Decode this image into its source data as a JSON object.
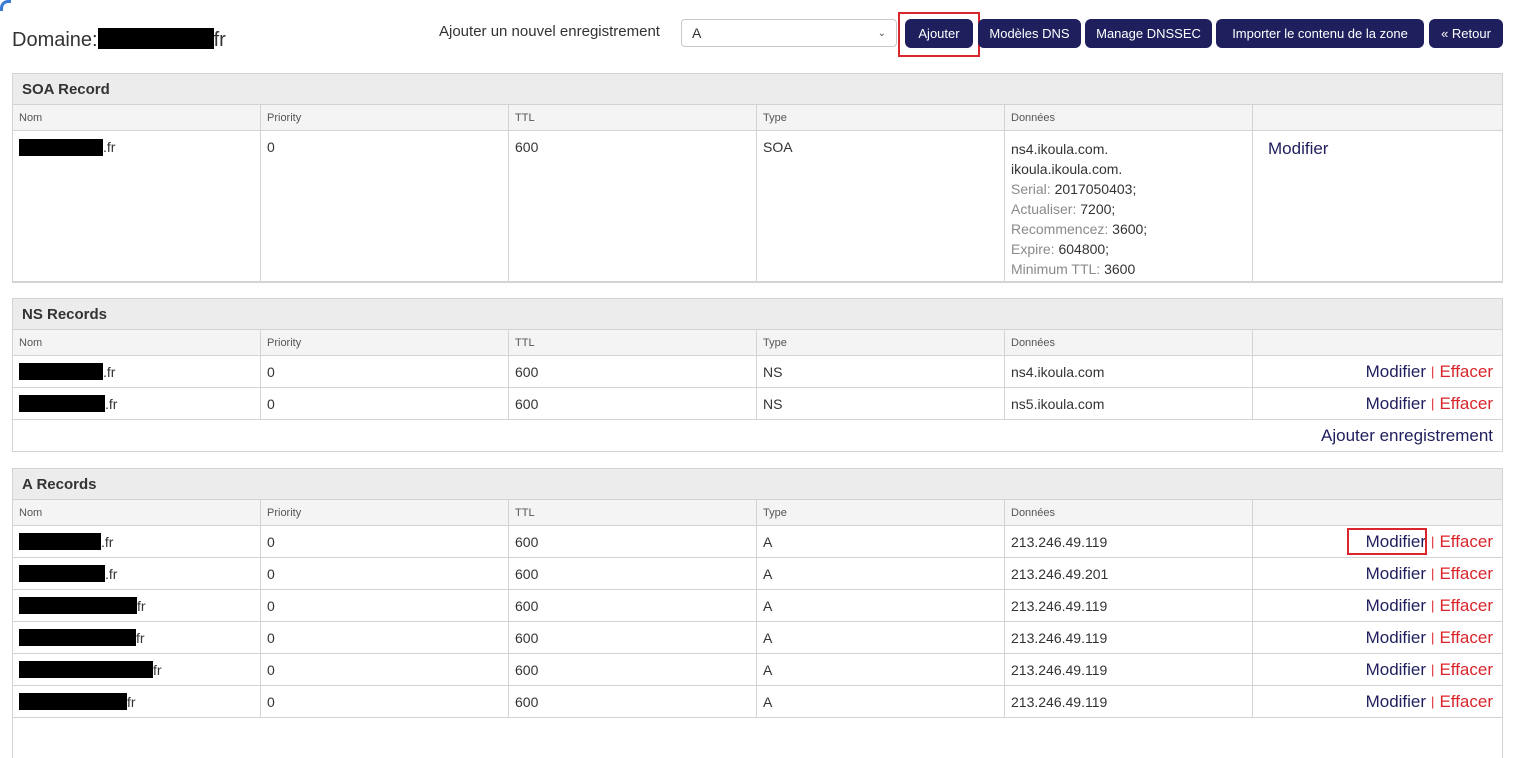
{
  "header": {
    "domain_label": "Domaine:",
    "domain_suffix": "fr",
    "add_label": "Ajouter un nouvel enregistrement",
    "record_type_value": "A",
    "buttons": {
      "add": "Ajouter",
      "dns_templates": "Modèles DNS",
      "dnssec": "Manage DNSSEC",
      "import_zone": "Importer le contenu de la zone",
      "back": "« Retour"
    }
  },
  "columns": {
    "name": "Nom",
    "priority": "Priority",
    "ttl": "TTL",
    "type": "Type",
    "data": "Données"
  },
  "actions": {
    "modify": "Modifier",
    "delete": "Effacer",
    "separator": "|",
    "add_record": "Ajouter enregistrement"
  },
  "soa": {
    "title": "SOA Record",
    "name_suffix": ".fr",
    "priority": "0",
    "ttl": "600",
    "type": "SOA",
    "primary_ns": "ns4.ikoula.com.",
    "hostmaster": "ikoula.ikoula.com.",
    "serial_label": "Serial:",
    "serial_value": "2017050403;",
    "refresh_label": "Actualiser:",
    "refresh_value": "7200;",
    "retry_label": "Recommencez:",
    "retry_value": "3600;",
    "expire_label": "Expire:",
    "expire_value": "604800;",
    "minttl_label": "Minimum TTL:",
    "minttl_value": "3600"
  },
  "ns": {
    "title": "NS Records",
    "rows": [
      {
        "name_suffix": ".fr",
        "priority": "0",
        "ttl": "600",
        "type": "NS",
        "data": "ns4.ikoula.com"
      },
      {
        "name_suffix": ".fr",
        "priority": "0",
        "ttl": "600",
        "type": "NS",
        "data": "ns5.ikoula.com"
      }
    ]
  },
  "a": {
    "title": "A Records",
    "rows": [
      {
        "name_suffix": ".fr",
        "priority": "0",
        "ttl": "600",
        "type": "A",
        "data": "213.246.49.119"
      },
      {
        "name_suffix": ".fr",
        "priority": "0",
        "ttl": "600",
        "type": "A",
        "data": "213.246.49.201"
      },
      {
        "name_suffix": "fr",
        "priority": "0",
        "ttl": "600",
        "type": "A",
        "data": "213.246.49.119"
      },
      {
        "name_suffix": "fr",
        "priority": "0",
        "ttl": "600",
        "type": "A",
        "data": "213.246.49.119"
      },
      {
        "name_suffix": "fr",
        "priority": "0",
        "ttl": "600",
        "type": "A",
        "data": "213.246.49.119"
      },
      {
        "name_suffix": "fr",
        "priority": "0",
        "ttl": "600",
        "type": "A",
        "data": "213.246.49.119"
      }
    ]
  }
}
